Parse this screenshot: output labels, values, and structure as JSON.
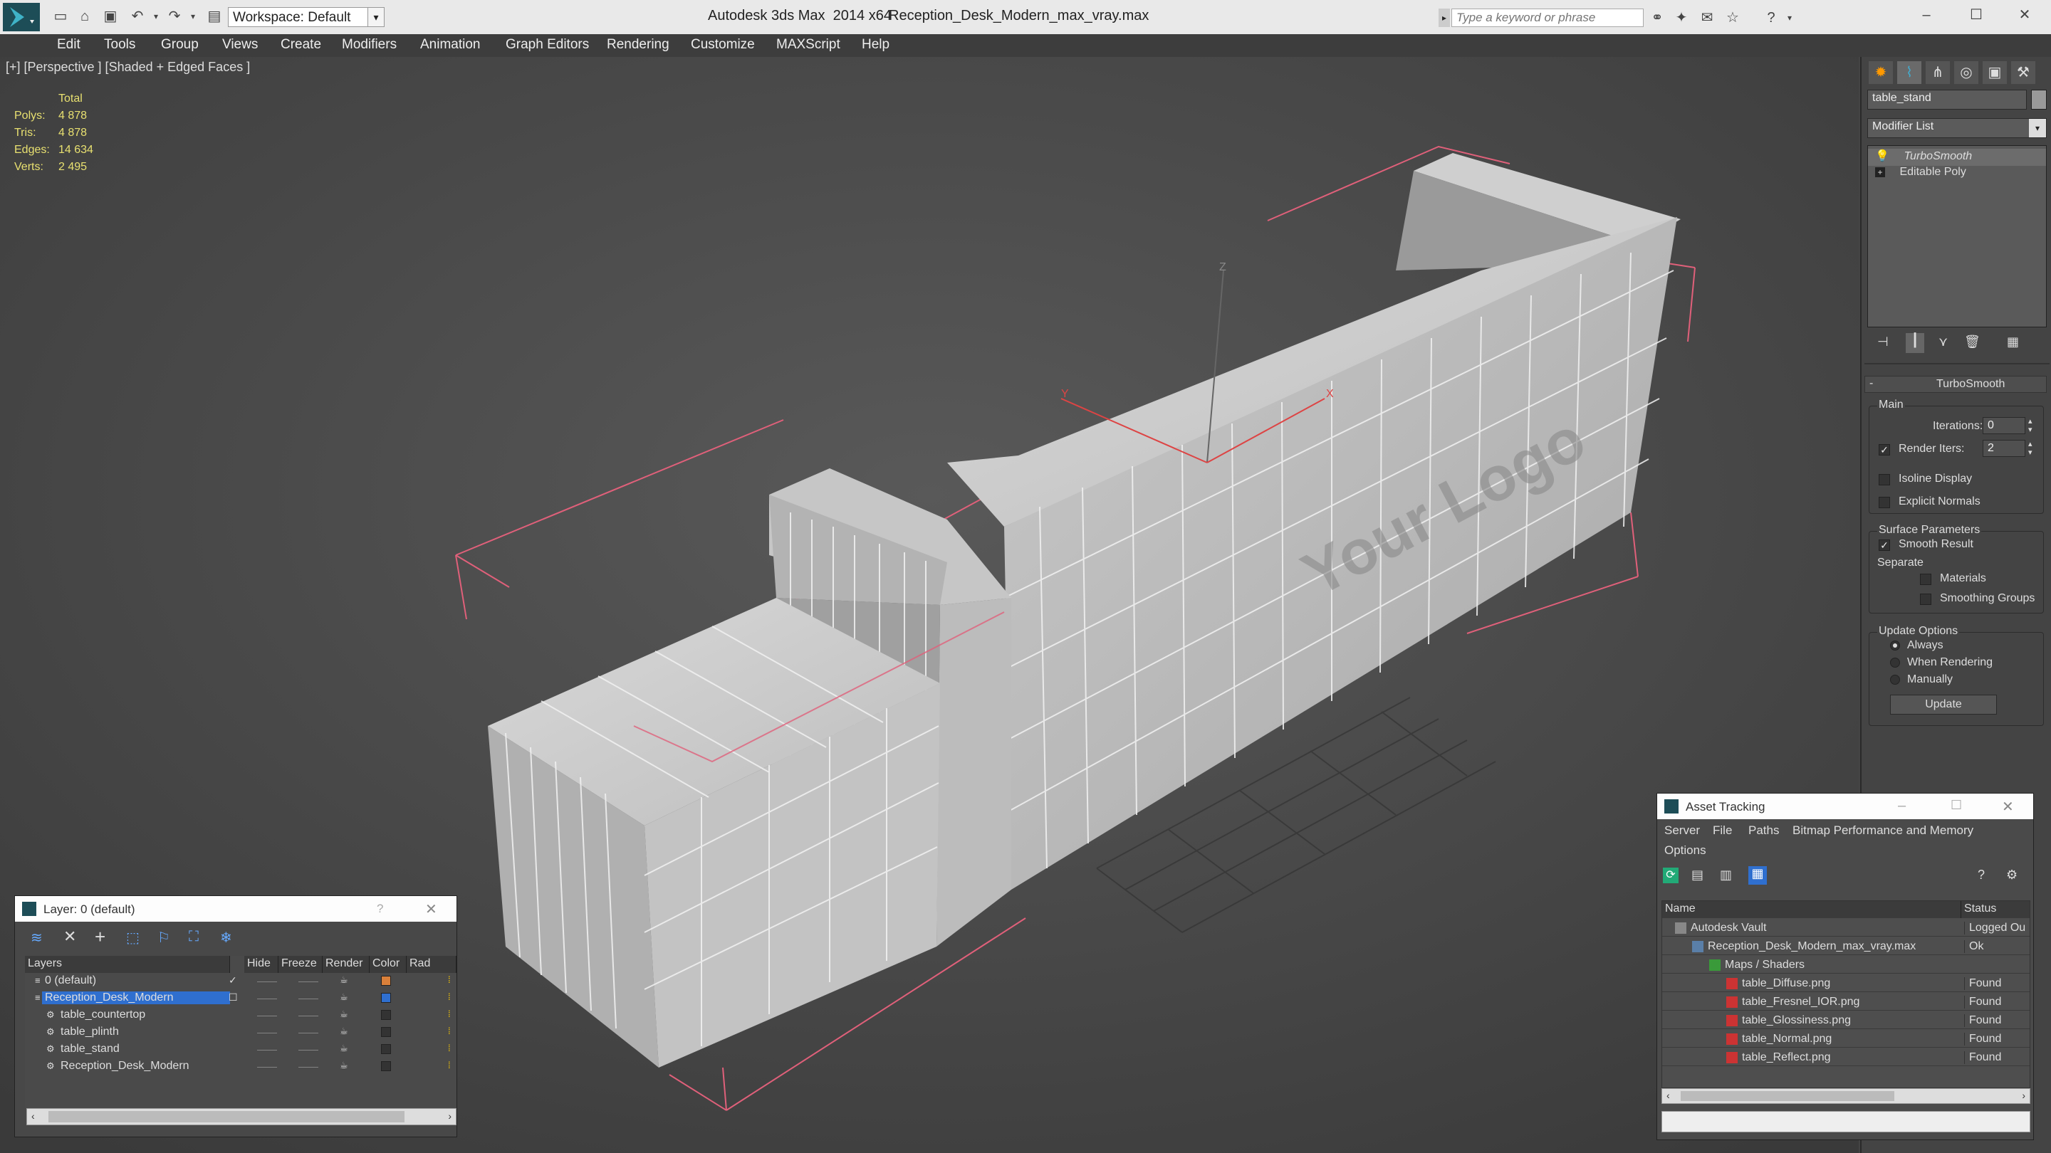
{
  "title_bar": {
    "app_title": "Autodesk 3ds Max  2014 x64",
    "file_name": "Reception_Desk_Modern_max_vray.max",
    "workspace_label": "Workspace: Default",
    "search_placeholder": "Type a keyword or phrase"
  },
  "menu": {
    "items": [
      "Edit",
      "Tools",
      "Group",
      "Views",
      "Create",
      "Modifiers",
      "Animation",
      "Graph Editors",
      "Rendering",
      "Customize",
      "MAXScript",
      "Help"
    ]
  },
  "viewport": {
    "label": "[+] [Perspective ] [Shaded + Edged Faces ]",
    "stats": {
      "header": "Total",
      "rows": [
        {
          "label": "Polys:",
          "value": "4 878"
        },
        {
          "label": "Tris:",
          "value": "4 878"
        },
        {
          "label": "Edges:",
          "value": "14 634"
        },
        {
          "label": "Verts:",
          "value": "2 495"
        }
      ]
    },
    "logo_text": "Your Logo",
    "axis_labels": {
      "x": "X",
      "y": "Y",
      "z": "Z"
    }
  },
  "command_panel": {
    "object_name": "table_stand",
    "modifier_list_label": "Modifier List",
    "stack": [
      "TurboSmooth",
      "Editable Poly"
    ],
    "rollout_title": "TurboSmooth",
    "main_label": "Main",
    "iterations_label": "Iterations:",
    "iterations_value": "0",
    "render_iters_label": "Render Iters:",
    "render_iters_value": "2",
    "isoline_label": "Isoline Display",
    "explicit_normals_label": "Explicit Normals",
    "surface_params_label": "Surface Parameters",
    "smooth_result_label": "Smooth Result",
    "separate_label": "Separate",
    "materials_label": "Materials",
    "smoothing_groups_label": "Smoothing Groups",
    "update_options_label": "Update Options",
    "always_label": "Always",
    "when_rendering_label": "When Rendering",
    "manually_label": "Manually",
    "update_button": "Update"
  },
  "layer_window": {
    "title": "Layer: 0 (default)",
    "help": "?",
    "columns": [
      "Layers",
      "Hide",
      "Freeze",
      "Render",
      "Color",
      "Rad"
    ],
    "rows": [
      {
        "name": "0 (default)",
        "color": "#d9803a",
        "indent": 0,
        "type": "layer"
      },
      {
        "name": "Reception_Desk_Modern",
        "color": "#2f6fcf",
        "indent": 0,
        "type": "layer",
        "selected": true
      },
      {
        "name": "table_countertop",
        "color": "#333333",
        "indent": 1,
        "type": "object"
      },
      {
        "name": "table_plinth",
        "color": "#333333",
        "indent": 1,
        "type": "object"
      },
      {
        "name": "table_stand",
        "color": "#333333",
        "indent": 1,
        "type": "object"
      },
      {
        "name": "Reception_Desk_Modern",
        "color": "#333333",
        "indent": 1,
        "type": "object"
      }
    ]
  },
  "asset_window": {
    "title": "Asset Tracking",
    "menus": [
      "Server",
      "File",
      "Paths",
      "Bitmap Performance and Memory"
    ],
    "menus2": [
      "Options"
    ],
    "columns": [
      "Name",
      "Status"
    ],
    "rows": [
      {
        "name": "Autodesk Vault",
        "status": "Logged Ou",
        "indent": 0
      },
      {
        "name": "Reception_Desk_Modern_max_vray.max",
        "status": "Ok",
        "indent": 1
      },
      {
        "name": "Maps / Shaders",
        "status": "",
        "indent": 2
      },
      {
        "name": "table_Diffuse.png",
        "status": "Found",
        "indent": 3
      },
      {
        "name": "table_Fresnel_IOR.png",
        "status": "Found",
        "indent": 3
      },
      {
        "name": "table_Glossiness.png",
        "status": "Found",
        "indent": 3
      },
      {
        "name": "table_Normal.png",
        "status": "Found",
        "indent": 3
      },
      {
        "name": "table_Reflect.png",
        "status": "Found",
        "indent": 3
      }
    ]
  }
}
